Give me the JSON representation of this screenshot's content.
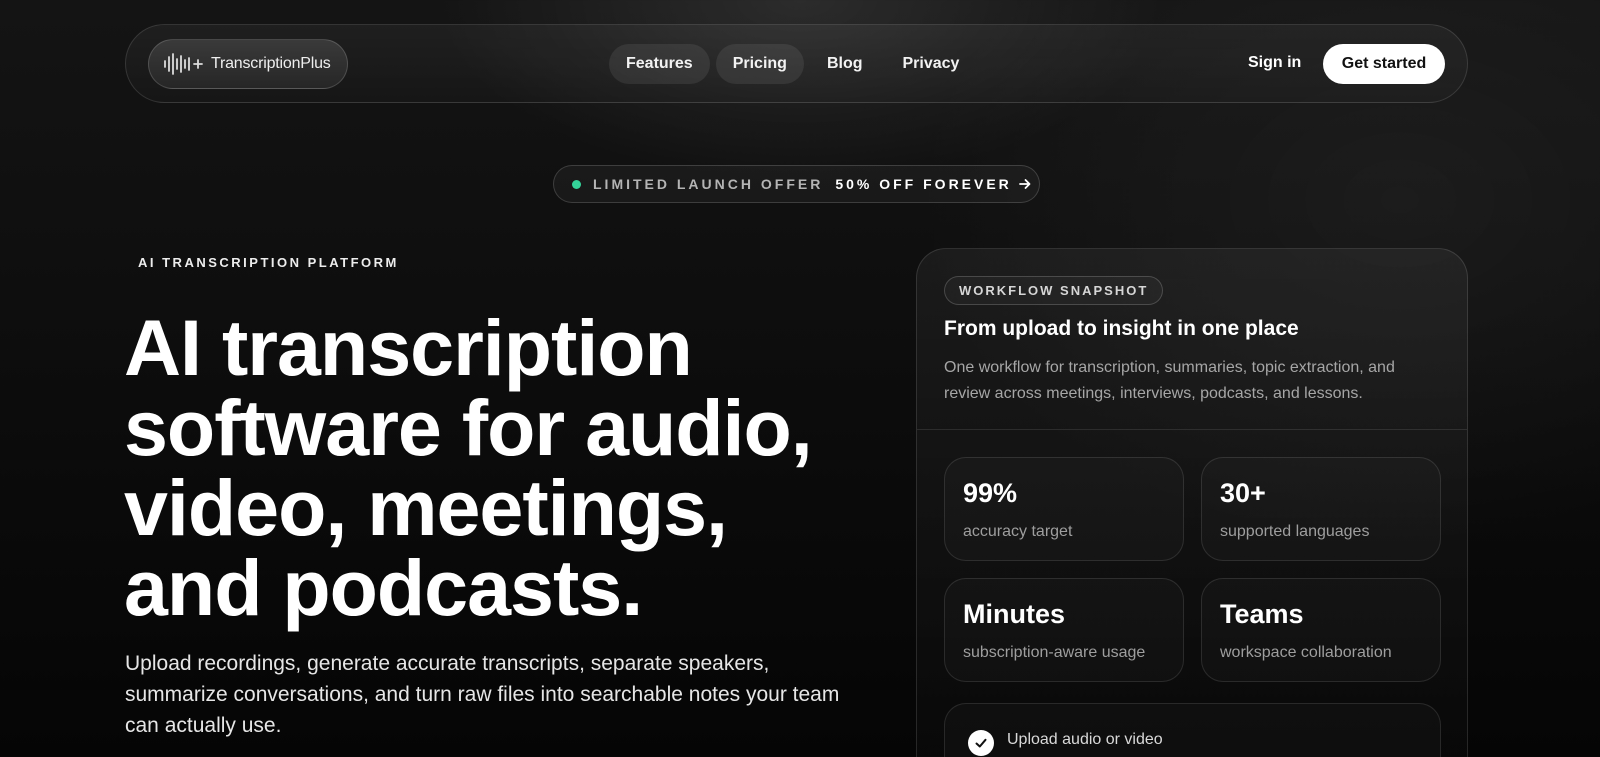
{
  "brand": {
    "name": "TranscriptionPlus",
    "icon": "waveform-plus-icon"
  },
  "nav": {
    "links": [
      {
        "label": "Features"
      },
      {
        "label": "Pricing"
      },
      {
        "label": "Blog"
      },
      {
        "label": "Privacy"
      }
    ],
    "signin_label": "Sign in",
    "cta_label": "Get started"
  },
  "offer": {
    "label": "LIMITED LAUNCH OFFER",
    "highlight": "50% OFF FOREVER",
    "icon": "arrow-right-icon",
    "dot_color": "#34d399"
  },
  "hero": {
    "eyebrow": "AI TRANSCRIPTION PLATFORM",
    "headline": "AI transcription software for audio, video, meetings, and podcasts.",
    "subtext": "Upload recordings, generate accurate transcripts, separate speakers, summarize conversations, and turn raw files into searchable notes your team can actually use."
  },
  "snapshot": {
    "chip": "WORKFLOW SNAPSHOT",
    "title": "From upload to insight in one place",
    "description": "One workflow for transcription, summaries, topic extraction, and review across meetings, interviews, podcasts, and lessons.",
    "stats": [
      {
        "value": "99%",
        "label": "accuracy target"
      },
      {
        "value": "30+",
        "label": "supported languages"
      },
      {
        "value": "Minutes",
        "label": "subscription-aware usage"
      },
      {
        "value": "Teams",
        "label": "workspace collaboration"
      }
    ],
    "steps": [
      {
        "label": "Upload audio or video",
        "icon": "check-icon"
      }
    ]
  }
}
